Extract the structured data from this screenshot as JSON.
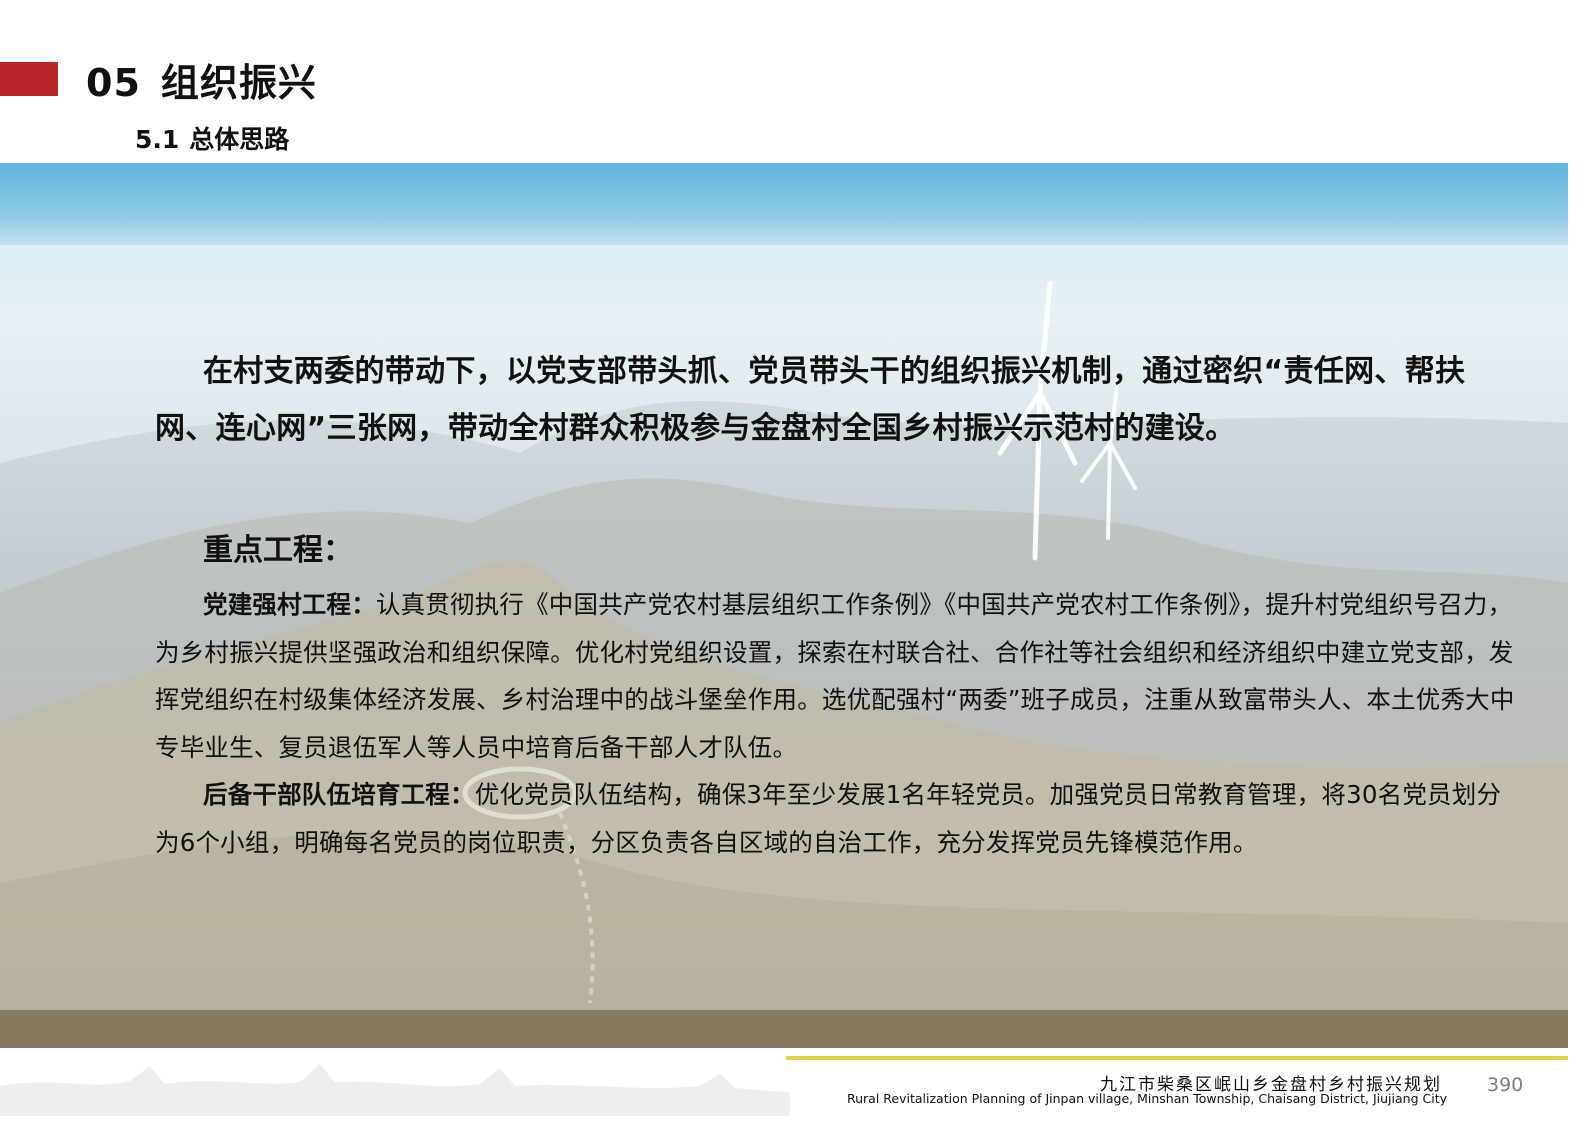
{
  "header": {
    "section_number": "05",
    "section_title": "组织振兴",
    "subsection_number": "5.1",
    "subsection_title": "总体思路",
    "accent_color": "#b8262b"
  },
  "body": {
    "intro": "在村支两委的带动下，以党支部带头抓、党员带头干的组织振兴机制，通过密织“责任网、帮扶网、连心网”三张网，带动全村群众积极参与金盘村全国乡村振兴示范村的建设。",
    "key_projects_heading": "重点工程：",
    "projects": [
      {
        "name": "党建强村工程：",
        "text": "认真贯彻执行《中国共产党农村基层组织工作条例》《中国共产党农村工作条例》，提升村党组织号召力，为乡村振兴提供坚强政治和组织保障。优化村党组织设置，探索在村联合社、合作社等社会组织和经济组织中建立党支部，发挥党组织在村级集体经济发展、乡村治理中的战斗堡垒作用。选优配强村“两委”班子成员，注重从致富带头人、本土优秀大中专毕业生、复员退伍军人等人员中培育后备干部人才队伍。"
      },
      {
        "name": "后备干部队伍培育工程：",
        "text": "优化党员队伍结构，确保3年至少发展1名年轻党员。加强党员日常教育管理，将30名党员划分为6个小组，明确每名党员的岗位职责，分区负责各自区域的自治工作，充分发挥党员先锋模范作用。"
      }
    ]
  },
  "footer": {
    "title_cn": "九江市柴桑区岷山乡金盘村乡村振兴规划",
    "title_en": "Rural Revitalization Planning of Jinpan village, Minshan Township, Chaisang District, Jiujiang City",
    "page_number": "390",
    "line_color": "#e8cf4a"
  }
}
